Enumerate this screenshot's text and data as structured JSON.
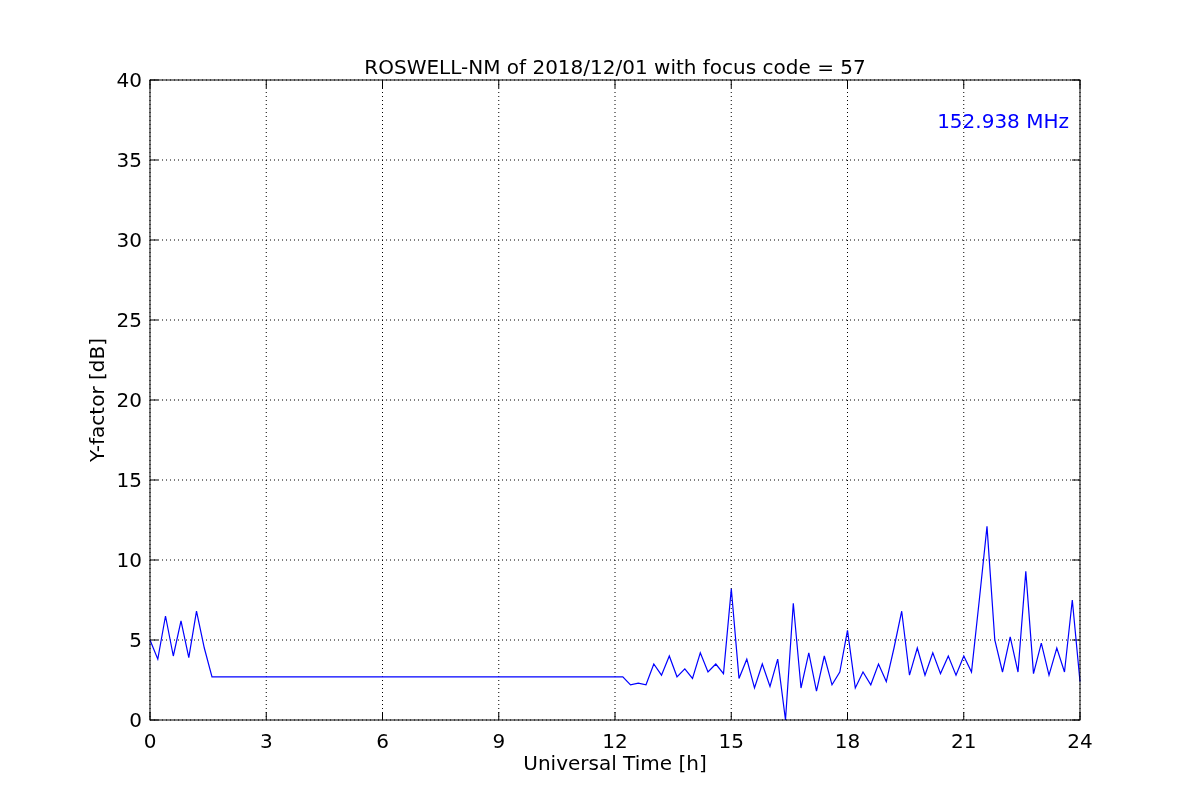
{
  "chart_data": {
    "type": "line",
    "title": "ROSWELL-NM of 2018/12/01 with focus code = 57",
    "xlabel": "Universal Time [h]",
    "ylabel": "Y-factor [dB]",
    "x": [
      0,
      0.2,
      0.4,
      0.6,
      0.8,
      1,
      1.2,
      1.4,
      1.6,
      1.8,
      2,
      2.2,
      2.4,
      2.6,
      2.8,
      3,
      3.2,
      3.4,
      3.6,
      3.8,
      4,
      4.2,
      4.4,
      4.6,
      4.8,
      5,
      5.2,
      5.4,
      5.6,
      5.8,
      6,
      6.2,
      6.4,
      6.6,
      6.8,
      7,
      7.2,
      7.4,
      7.6,
      7.8,
      8,
      8.2,
      8.4,
      8.6,
      8.8,
      9,
      9.2,
      9.4,
      9.6,
      9.8,
      10,
      10.2,
      10.4,
      10.6,
      10.8,
      11,
      11.2,
      11.4,
      11.6,
      11.8,
      12,
      12.2,
      12.4,
      12.6,
      12.8,
      13,
      13.2,
      13.4,
      13.6,
      13.8,
      14,
      14.2,
      14.4,
      14.6,
      14.8,
      15,
      15.2,
      15.4,
      15.6,
      15.8,
      16,
      16.2,
      16.4,
      16.6,
      16.8,
      17,
      17.2,
      17.4,
      17.6,
      17.8,
      18,
      18.2,
      18.4,
      18.6,
      18.8,
      19,
      19.2,
      19.4,
      19.6,
      19.8,
      20,
      20.2,
      20.4,
      20.6,
      20.8,
      21,
      21.2,
      21.4,
      21.6,
      21.8,
      22,
      22.2,
      22.4,
      22.6,
      22.8,
      23,
      23.2,
      23.4,
      23.6,
      23.8,
      24
    ],
    "series": [
      {
        "name": "152.938 MHz",
        "color": "#0000ff",
        "values": [
          5.0,
          3.8,
          6.5,
          4.0,
          6.2,
          3.9,
          6.8,
          4.5,
          2.7,
          2.7,
          2.7,
          2.7,
          2.7,
          2.7,
          2.7,
          2.7,
          2.7,
          2.7,
          2.7,
          2.7,
          2.7,
          2.7,
          2.7,
          2.7,
          2.7,
          2.7,
          2.7,
          2.7,
          2.7,
          2.7,
          2.7,
          2.7,
          2.7,
          2.7,
          2.7,
          2.7,
          2.7,
          2.7,
          2.7,
          2.7,
          2.7,
          2.7,
          2.7,
          2.7,
          2.7,
          2.7,
          2.7,
          2.7,
          2.7,
          2.7,
          2.7,
          2.7,
          2.7,
          2.7,
          2.7,
          2.7,
          2.7,
          2.7,
          2.7,
          2.7,
          2.7,
          2.7,
          2.2,
          2.3,
          2.2,
          3.5,
          2.8,
          4.0,
          2.7,
          3.2,
          2.6,
          4.2,
          3.0,
          3.5,
          2.9,
          8.2,
          2.6,
          3.8,
          2.0,
          3.5,
          2.1,
          3.8,
          0.0,
          7.3,
          2.0,
          4.2,
          1.8,
          4.0,
          2.2,
          3.0,
          5.6,
          2.0,
          3.0,
          2.2,
          3.5,
          2.4,
          4.5,
          6.8,
          2.8,
          4.5,
          2.8,
          4.2,
          2.9,
          4.0,
          2.8,
          4.0,
          3.0,
          7.5,
          12.1,
          5.0,
          3.0,
          5.2,
          3.0,
          9.3,
          2.9,
          4.8,
          2.8,
          4.5,
          3.0,
          7.5,
          2.4
        ]
      }
    ],
    "xlim": [
      0,
      24
    ],
    "ylim": [
      0,
      40
    ],
    "xticks": [
      0,
      3,
      6,
      9,
      12,
      15,
      18,
      21,
      24
    ],
    "yticks": [
      0,
      5,
      10,
      15,
      20,
      25,
      30,
      35,
      40
    ],
    "grid": true
  }
}
